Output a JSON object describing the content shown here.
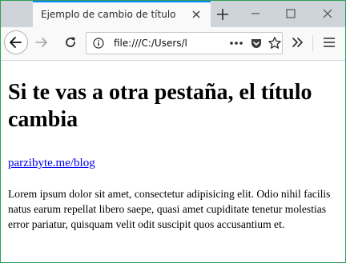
{
  "tab": {
    "title": "Ejemplo de cambio de título"
  },
  "address_bar": {
    "url": "file:///C:/Users/l"
  },
  "page": {
    "heading": "Si te vas a otra pestaña, el título cambia",
    "link_text": "parzibyte.me/blog",
    "paragraph": "Lorem ipsum dolor sit amet, consectetur adipisicing elit. Odio nihil facilis natus earum repellat libero saepe, quasi amet cupiditate tenetur molestias error pariatur, quisquam velit odit suscipit quos accusantium et."
  },
  "icons": {
    "tab_close": "close-icon",
    "new_tab": "plus-icon",
    "minimize": "minimize-icon",
    "maximize": "maximize-icon",
    "window_close": "close-icon",
    "back": "arrow-left-icon",
    "forward": "arrow-right-icon",
    "reload": "reload-icon",
    "site_info": "info-icon",
    "page_actions": "more-icon",
    "pocket": "pocket-icon",
    "bookmark": "star-icon",
    "overflow": "chevron-double-right-icon",
    "menu": "hamburger-menu-icon"
  },
  "colors": {
    "tab_accent": "#0a84ff",
    "tabstrip": "#cfd4da",
    "toolbar": "#f9f9fa",
    "link": "#0000ee",
    "window_border": "#2f9e58"
  }
}
